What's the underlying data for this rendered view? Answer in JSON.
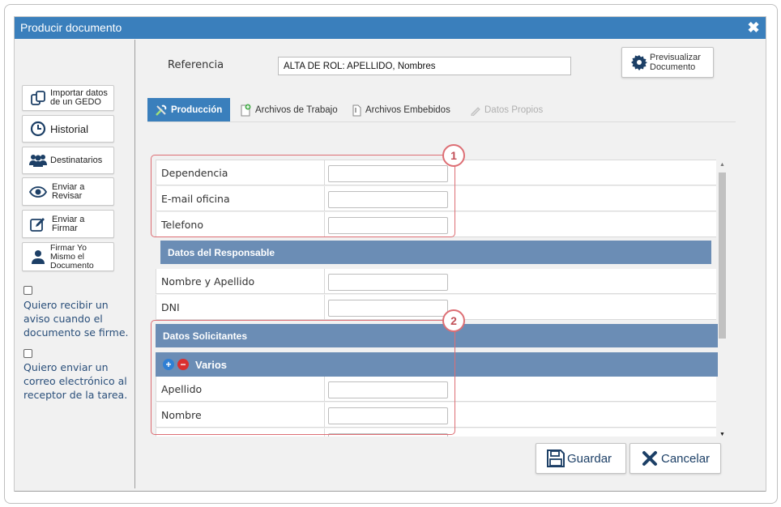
{
  "dialog": {
    "title": "Producir documento",
    "close_icon": "close-icon"
  },
  "sidebar": {
    "buttons": [
      {
        "label": "Importar datos de un GEDO",
        "icon": "import-icon"
      },
      {
        "label": "Historial",
        "icon": "clock-icon"
      },
      {
        "label": "Destinatarios",
        "icon": "users-icon"
      },
      {
        "label": "Enviar a Revisar",
        "icon": "eye-icon"
      },
      {
        "label": "Enviar a Firmar",
        "icon": "pen-icon"
      },
      {
        "label": "Firmar Yo Mismo el Documento",
        "icon": "user-icon"
      }
    ],
    "checkboxes": [
      {
        "label": "Quiero recibir un aviso cuando el documento se firme.",
        "checked": false
      },
      {
        "label": "Quiero enviar un correo electrónico al receptor de la tarea.",
        "checked": false
      }
    ]
  },
  "reference": {
    "label": "Referencia",
    "value": "ALTA DE ROL: APELLIDO, Nombres"
  },
  "preview_button": {
    "line1": "Previsualizar",
    "line2": "Documento"
  },
  "tabs": [
    {
      "label": "Producción",
      "active": true
    },
    {
      "label": "Archivos de Trabajo",
      "active": false
    },
    {
      "label": "Archivos Embebidos",
      "active": false
    },
    {
      "label": "Datos Propios",
      "active": false,
      "disabled": true
    }
  ],
  "form": {
    "rows_top": [
      "Dependencia",
      "E-mail oficina",
      "Telefono"
    ],
    "section_responsable": "Datos del Responsable",
    "rows_responsable": [
      "Nombre y Apellido",
      "DNI"
    ],
    "section_solicitantes": "Datos Solicitantes",
    "subsection_varios": "Varios",
    "rows_varios": [
      "Apellido",
      "Nombre"
    ]
  },
  "callouts": [
    "1",
    "2"
  ],
  "actions": {
    "save": "Guardar",
    "cancel": "Cancelar"
  },
  "colors": {
    "title_bar": "#3a7fbc",
    "section": "#6b8db5",
    "callout": "#dd6e74"
  }
}
